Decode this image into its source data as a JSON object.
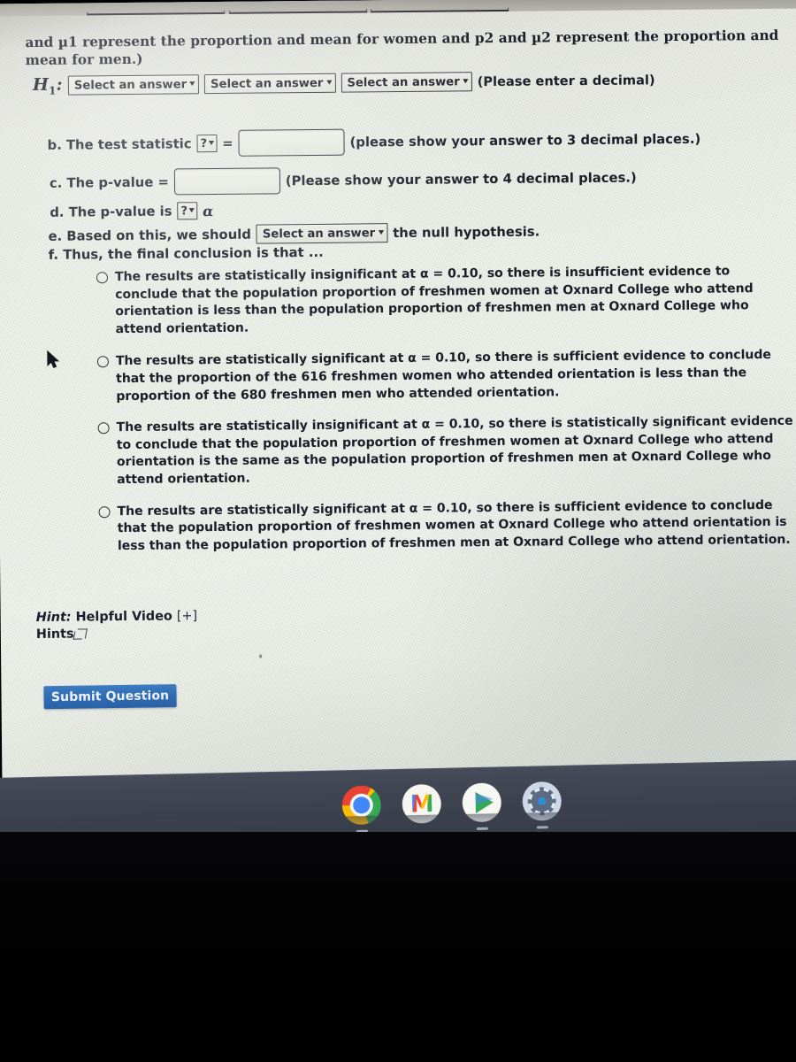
{
  "page": {
    "intro_text": "and µ1 represent the proportion and mean for women and p2 and µ2 represent the proportion and mean for men.)",
    "h1_symbol": "H",
    "h1_subscript": "1",
    "h1_colon": ":",
    "h1_note": "(Please enter a decimal)",
    "select_placeholder": "Select an answer",
    "caret_glyph": "▾",
    "question_mark_glyph": "?"
  },
  "steps": {
    "b_label": "b. The test statistic",
    "b_equals": "=",
    "b_note": "(please show your answer to 3 decimal places.)",
    "b_value": "",
    "c_label": "c. The p-value =",
    "c_note": "(Please show your answer to 4 decimal places.)",
    "c_value": "",
    "d_label": "d. The p-value is",
    "d_alpha": "α",
    "e_label_before": "e. Based on this, we should",
    "e_label_after": "the null hypothesis.",
    "f_label": "f. Thus, the final conclusion is that ..."
  },
  "options": [
    {
      "id": "option-1",
      "selected": false,
      "text": "The results are statistically insignificant at α = 0.10, so there is insufficient evidence to conclude that the population proportion of freshmen women at Oxnard College who attend orientation is less than the population proportion of freshmen men at Oxnard College who attend orientation."
    },
    {
      "id": "option-2",
      "selected": false,
      "text": "The results are statistically significant at α = 0.10, so there is sufficient evidence to conclude that the proportion of the 616 freshmen women who attended orientation is less than the proportion of the 680 freshmen men who attended orientation."
    },
    {
      "id": "option-3",
      "selected": false,
      "text": "The results are statistically insignificant at α = 0.10, so there is statistically significant evidence to conclude that the population proportion of freshmen women at Oxnard College who attend orientation is the same as the population proportion of freshmen men at Oxnard College who attend orientation."
    },
    {
      "id": "option-4",
      "selected": false,
      "text": "The results are statistically significant at α = 0.10, so there is sufficient evidence to conclude that the population proportion of freshmen women at Oxnard College who attend orientation is less than the population proportion of freshmen men at Oxnard College who attend orientation."
    }
  ],
  "hint": {
    "label": "Hint:",
    "link_text": "Helpful Video",
    "expander": "[+]",
    "hints_label": "Hints"
  },
  "submit": {
    "label": "Submit Question"
  },
  "dock": {
    "items": [
      {
        "name": "chrome-icon",
        "label": "Chrome"
      },
      {
        "name": "gmail-icon",
        "label": "Gmail",
        "glyph": "M"
      },
      {
        "name": "play-store-icon",
        "label": "Play Store"
      },
      {
        "name": "settings-icon",
        "label": "Settings"
      }
    ]
  },
  "colors": {
    "accent_button": "#2f6cb4",
    "shelf": "#3e4350",
    "page_bg": "#eef0e9",
    "text": "#1d1d29"
  }
}
